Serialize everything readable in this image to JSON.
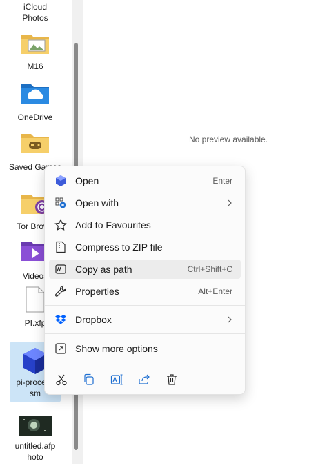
{
  "files": [
    {
      "label": "iCloud\nPhotos",
      "icon": "icloud-folder-icon"
    },
    {
      "label": "M16",
      "icon": "folder-icon"
    },
    {
      "label": "OneDrive",
      "icon": "onedrive-folder-icon"
    },
    {
      "label": "Saved\nGames",
      "icon": "saved-games-folder-icon"
    },
    {
      "label": "Tor Brows",
      "icon": "tor-browser-folder-icon"
    },
    {
      "label": "Videos",
      "icon": "videos-folder-icon"
    },
    {
      "label": "PI.xfp",
      "icon": "blank-file-icon"
    },
    {
      "label": "pi-process\nsm",
      "icon": "cube-file-icon"
    },
    {
      "label": "untitled.afp\nhoto",
      "icon": "photo-thumbnail-icon"
    }
  ],
  "preview": {
    "message": "No preview available."
  },
  "context_menu": {
    "items": [
      {
        "label": "Open",
        "shortcut": "Enter",
        "icon": "open-icon"
      },
      {
        "label": "Open with",
        "shortcut": "",
        "icon": "open-with-icon"
      },
      {
        "label": "Add to Favourites",
        "shortcut": "",
        "icon": "star-icon"
      },
      {
        "label": "Compress to ZIP file",
        "shortcut": "",
        "icon": "zip-icon"
      },
      {
        "label": "Copy as path",
        "shortcut": "Ctrl+Shift+C",
        "icon": "copy-path-icon"
      },
      {
        "label": "Properties",
        "shortcut": "Alt+Enter",
        "icon": "wrench-icon"
      },
      {
        "label": "Dropbox",
        "shortcut": "",
        "icon": "dropbox-icon"
      },
      {
        "label": "Show more options",
        "shortcut": "",
        "icon": "more-options-icon"
      }
    ],
    "hovered_item": "Copy as path",
    "actions": [
      "cut",
      "copy",
      "rename",
      "share",
      "delete"
    ]
  },
  "colors": {
    "accent": "#0067c0",
    "selection": "#cce4f7",
    "hover": "#ececec"
  }
}
